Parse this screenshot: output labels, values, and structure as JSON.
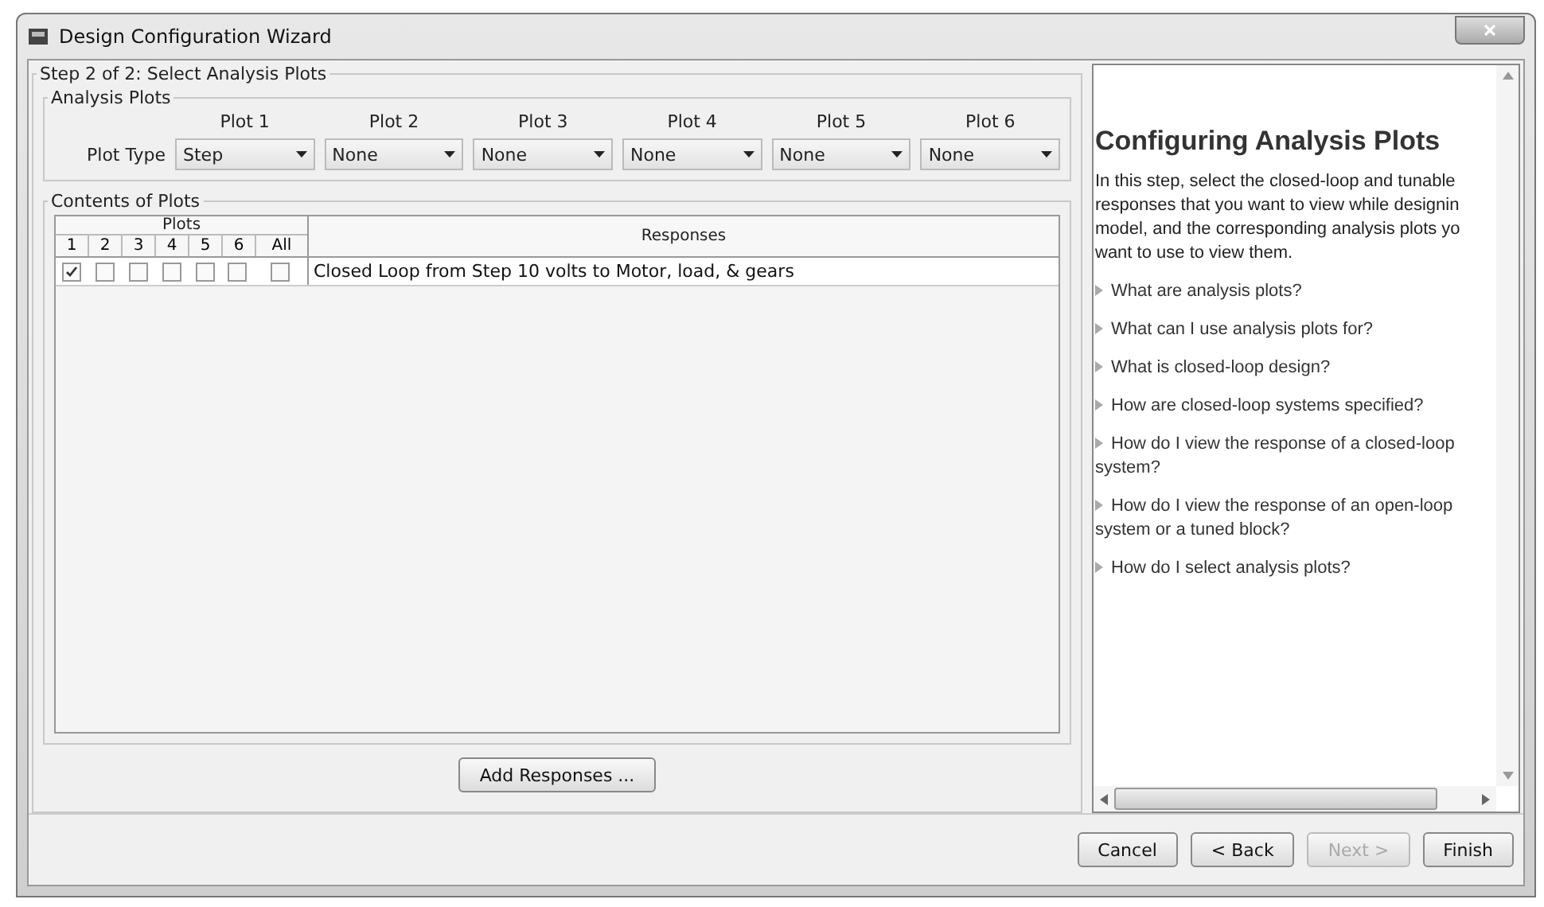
{
  "window": {
    "title": "Design Configuration Wizard"
  },
  "step": {
    "title": "Step 2 of 2: Select Analysis Plots"
  },
  "analysis_plots": {
    "title": "Analysis Plots",
    "row_label": "Plot Type",
    "plots": [
      {
        "label": "Plot 1",
        "value": "Step"
      },
      {
        "label": "Plot 2",
        "value": "None"
      },
      {
        "label": "Plot 3",
        "value": "None"
      },
      {
        "label": "Plot 4",
        "value": "None"
      },
      {
        "label": "Plot 5",
        "value": "None"
      },
      {
        "label": "Plot 6",
        "value": "None"
      }
    ]
  },
  "contents": {
    "title": "Contents of Plots",
    "group_header": "Plots",
    "columns": [
      "1",
      "2",
      "3",
      "4",
      "5",
      "6",
      "All"
    ],
    "responses_header": "Responses",
    "rows": [
      {
        "checks": [
          true,
          false,
          false,
          false,
          false,
          false,
          false
        ],
        "response": "Closed Loop from Step 10 volts to Motor, load, & gears"
      }
    ]
  },
  "add_button": "Add Responses ...",
  "help": {
    "title": "Configuring Analysis Plots",
    "intro_lines": [
      "In this step, select the closed-loop and tunable",
      "responses that you want to view while designin",
      "model, and the corresponding analysis plots yo",
      "want to use to view them."
    ],
    "topics": [
      "What are analysis plots?",
      "What can I use analysis plots for?",
      "What is closed-loop design?",
      "How are closed-loop systems specified?",
      "How do I view the response of a closed-loop system?",
      "How do I view the response of an open-loop system or a tuned block?",
      "How do I select analysis plots?"
    ]
  },
  "buttons": [
    {
      "label": "Cancel",
      "disabled": false
    },
    {
      "label": "< Back",
      "disabled": false
    },
    {
      "label": "Next >",
      "disabled": true
    },
    {
      "label": "Finish",
      "disabled": false
    }
  ]
}
